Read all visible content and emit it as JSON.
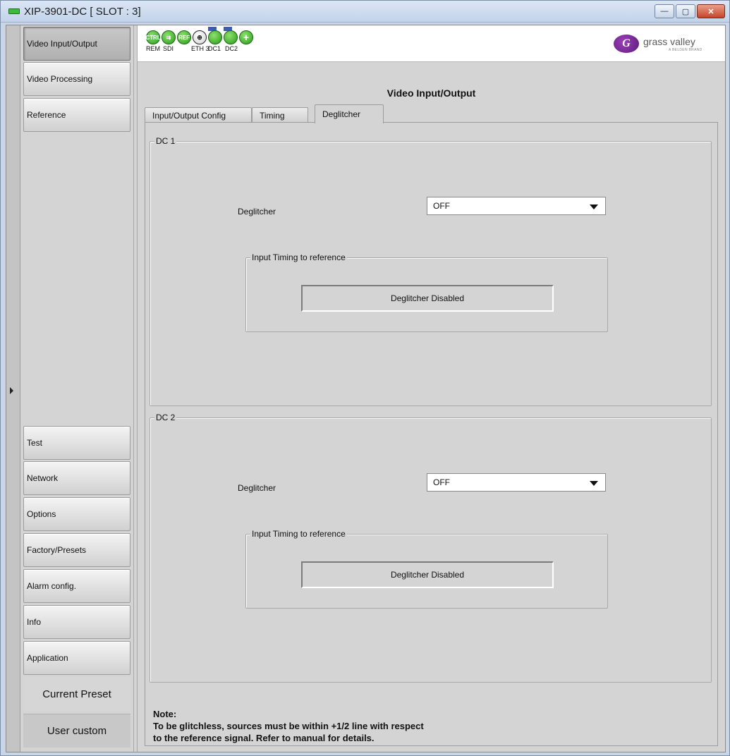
{
  "window": {
    "title": "XIP-3901-DC [ SLOT : 3]",
    "controls": {
      "minimize": "—",
      "maximize": "▢",
      "close": "✕"
    }
  },
  "sidebar": {
    "items": [
      {
        "label": "Video Input/Output",
        "active": true
      },
      {
        "label": "Video Processing",
        "active": false
      },
      {
        "label": "Reference",
        "active": false
      },
      {
        "label": "Test",
        "active": false
      },
      {
        "label": "Network",
        "active": false
      },
      {
        "label": "Options",
        "active": false
      },
      {
        "label": "Factory/Presets",
        "active": false
      },
      {
        "label": "Alarm config.",
        "active": false
      },
      {
        "label": "Info",
        "active": false
      },
      {
        "label": "Application",
        "active": false
      }
    ],
    "current_preset_label": "Current Preset",
    "preset_value": "User custom"
  },
  "status_bar": {
    "icons": [
      {
        "name": "ctrl",
        "glyph": "CTRL",
        "label": "REM"
      },
      {
        "name": "sdi",
        "glyph": "⇉",
        "label": "SDI"
      },
      {
        "name": "ref",
        "glyph": "REF",
        "label": ""
      },
      {
        "name": "eth",
        "glyph": "⊕",
        "label": "ETH 3"
      },
      {
        "name": "dc1",
        "glyph": "",
        "label": "DC1"
      },
      {
        "name": "dc2",
        "glyph": "",
        "label": "DC2"
      },
      {
        "name": "plus",
        "glyph": "+",
        "label": ""
      }
    ],
    "logo_text": "grass valley",
    "logo_sub": "A BELDEN BRAND"
  },
  "page": {
    "title": "Video Input/Output",
    "tabs": [
      {
        "label": "Input/Output Config",
        "active": false
      },
      {
        "label": "Timing",
        "active": false
      },
      {
        "label": "Deglitcher",
        "active": true
      }
    ]
  },
  "dc1": {
    "group_title": "DC 1",
    "deglitcher_label": "Deglitcher",
    "deglitcher_value": "OFF",
    "timing_group_title": "Input Timing to reference",
    "timing_readout": "Deglitcher Disabled"
  },
  "dc2": {
    "group_title": "DC 2",
    "deglitcher_label": "Deglitcher",
    "deglitcher_value": "OFF",
    "timing_group_title": "Input Timing to reference",
    "timing_readout": "Deglitcher Disabled"
  },
  "note": {
    "heading": "Note:",
    "line1": "To be glitchless, sources must be within +1/2 line with respect",
    "line2": "to the reference signal. Refer to manual for details."
  },
  "colors": {
    "panel_bg": "#d4d4d4",
    "titlebar": "#c2d3ea",
    "status_green": "#2a9a1e",
    "logo_purple": "#5a1b7a",
    "close_red": "#c5452b"
  }
}
